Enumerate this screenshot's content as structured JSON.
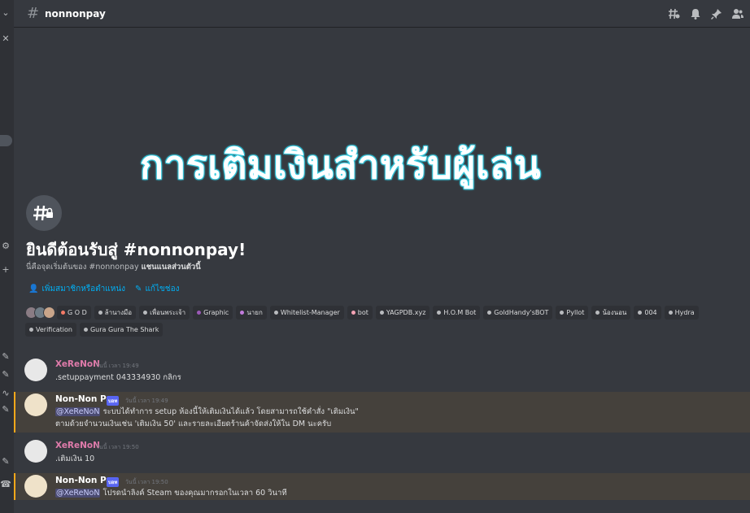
{
  "header": {
    "channel_name": "nonnonpay"
  },
  "banner": {
    "text": "การเติมเงินสำหรับผู้เล่น"
  },
  "welcome": {
    "title": "ยินดีต้อนรับสู่ #nonnonpay!",
    "subtitle_prefix": "นี่คือจุดเริ่มต้นของ #nonnonpay ",
    "subtitle_bold": "แชนแนลส่วนตัวนี้",
    "add_members": "เพิ่มสมาชิกหรือตำแหน่ง",
    "edit_channel": "แก้ไขช่อง"
  },
  "roles": [
    {
      "label": "G O D",
      "color": "#f47b67"
    },
    {
      "label": "ล้านางมือ",
      "color": "#b9bbbe"
    },
    {
      "label": "เพื่อนพระเจ้า",
      "color": "#b9bbbe"
    },
    {
      "label": "Graphic",
      "color": "#9b59b6"
    },
    {
      "label": "นายก",
      "color": "#c27cdc"
    },
    {
      "label": "Whitelist-Manager",
      "color": "#b9bbbe"
    },
    {
      "label": "bot",
      "color": "#f4a3b4"
    },
    {
      "label": "YAGPDB.xyz",
      "color": "#b9bbbe"
    },
    {
      "label": "H.O.M Bot",
      "color": "#b9bbbe"
    },
    {
      "label": "GoldHandy'sBOT",
      "color": "#b9bbbe"
    },
    {
      "label": "Pyllot",
      "color": "#b9bbbe"
    },
    {
      "label": "น้องนอน",
      "color": "#b9bbbe"
    },
    {
      "label": "004",
      "color": "#b9bbbe"
    },
    {
      "label": "Hydra",
      "color": "#b9bbbe"
    },
    {
      "label": "Verification",
      "color": "#b9bbbe"
    },
    {
      "label": "Gura Gura The Shark",
      "color": "#b9bbbe"
    }
  ],
  "messages": [
    {
      "author": "XeReNoN",
      "time": "วันนี้ เวลา 19:49",
      "lines": [
        ".setuppayment 043334930 กลิกร"
      ]
    },
    {
      "author": "Non-Non Pay",
      "bot_tag": "บอท",
      "time": "วันนี้ เวลา 19:49",
      "mention": "@XeReNoN",
      "line1": " ระบบได้ทำการ setup ห้องนี้ให้เติมเงินได้แล้ว โดยสามารถใช้คำสั่ง \"เติมเงิน\"",
      "line2": "ตามด้วยจำนวนเงินเช่น 'เติมเงิน 50' และรายละเอียดร้านค้าจัดส่งให้ใน DM นะครับ"
    },
    {
      "author": "XeReNoN",
      "time": "วันนี้ เวลา 19:50",
      "lines": [
        ".เติมเงิน 10"
      ]
    },
    {
      "author": "Non-Non Pay",
      "bot_tag": "บอท",
      "time": "วันนี้ เวลา 19:50",
      "mention": "@XeReNoN",
      "line1": " โปรดนำลิงค์ Steam ของคุณมากรอกในเวลา 60 วินาที"
    }
  ]
}
